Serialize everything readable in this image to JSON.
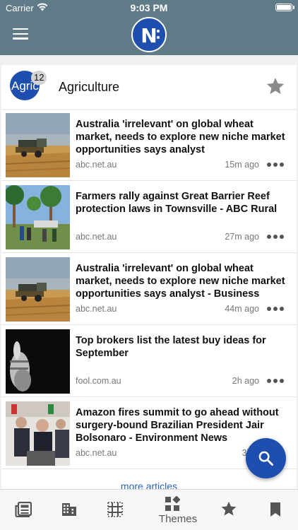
{
  "status_bar": {
    "carrier": "Carrier",
    "time": "9:03 PM"
  },
  "header": {
    "menu_icon": "hamburger-icon",
    "logo_letter": "N"
  },
  "topic": {
    "avatar_text": "Agric",
    "badge_count": "12",
    "title": "Agriculture",
    "favorite_icon": "star-icon"
  },
  "articles": [
    {
      "headline": "Australia 'irrelevant' on global wheat market, needs to explore new niche market opportunities says analyst",
      "source": "abc.net.au",
      "ago": "15m ago",
      "thumb": "harvester-wheat-field"
    },
    {
      "headline": "Farmers rally against Great Barrier Reef protection laws in Townsville - ABC Rural",
      "source": "abc.net.au",
      "ago": "27m ago",
      "thumb": "rally-under-palm-trees"
    },
    {
      "headline": "Australia 'irrelevant' on global wheat market, needs to explore new niche market opportunities says analyst - Business",
      "source": "abc.net.au",
      "ago": "44m ago",
      "thumb": "harvester-wheat-field"
    },
    {
      "headline": "Top brokers list the latest buy ideas for September",
      "source": "fool.com.au",
      "ago": "2h ago",
      "thumb": "thumbs-up-dark"
    },
    {
      "headline": "Amazon fires summit to go ahead without surgery-bound Brazilian President Jair Bolsonaro - Environment News",
      "source": "abc.net.au",
      "ago": "3h a",
      "thumb": "press-conference"
    }
  ],
  "more_articles_label": "more articles",
  "fab": {
    "icon": "search-icon"
  },
  "tabbar": {
    "tabs": [
      {
        "icon": "newspaper-icon",
        "label": ""
      },
      {
        "icon": "building-icon",
        "label": ""
      },
      {
        "icon": "grid-icon",
        "label": ""
      },
      {
        "icon": "themes-icon",
        "label": "Themes"
      },
      {
        "icon": "star-icon",
        "label": ""
      },
      {
        "icon": "bookmark-icon",
        "label": ""
      }
    ]
  },
  "colors": {
    "header": "#5f7b88",
    "brand": "#1f4fae",
    "link": "#2a62b5"
  }
}
